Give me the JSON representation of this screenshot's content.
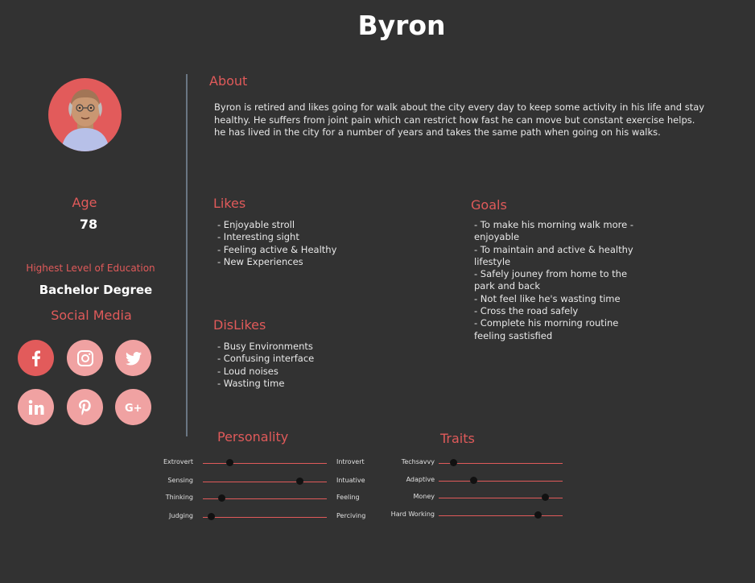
{
  "name": "Byron",
  "about": {
    "heading": "About",
    "text": "Byron is retired and likes going for walk about the city every day to keep some activity in his life and stay healthy. He suffers from joint pain which can restrict how fast he can move but constant exercise helps. he has lived in the city for a number of years and takes the same path when going on his walks."
  },
  "profile": {
    "age_label": "Age",
    "age_value": "78",
    "education_label": "Highest Level of Education",
    "education_value": "Bachelor Degree",
    "social_label": "Social Media",
    "social_icons": [
      "facebook-icon",
      "instagram-icon",
      "twitter-icon",
      "linkedin-icon",
      "pinterest-icon",
      "google-plus-icon"
    ]
  },
  "likes": {
    "heading": "Likes",
    "items": [
      "- Enjoyable stroll",
      "- Interesting sight",
      "- Feeling active & Healthy",
      "- New Experiences"
    ]
  },
  "dislikes": {
    "heading": "DisLikes",
    "items": [
      "- Busy Environments",
      "- Confusing interface",
      "- Loud noises",
      "- Wasting time"
    ]
  },
  "goals": {
    "heading": "Goals",
    "items": [
      "- To make his morning walk more -",
      "enjoyable",
      "- To maintain and active & healthy",
      "lifestyle",
      "- Safely jouney from home to the",
      "park and back",
      "- Not feel like he's wasting time",
      "- Cross the road safely",
      "- Complete his morning routine",
      "feeling sastisfied"
    ]
  },
  "personality": {
    "heading": "Personality",
    "rows": [
      {
        "left": "Extrovert",
        "right": "Introvert",
        "value": 0.22
      },
      {
        "left": "Sensing",
        "right": "Intuative",
        "value": 0.78
      },
      {
        "left": "Thinking",
        "right": "Feeling",
        "value": 0.15
      },
      {
        "left": "Judging",
        "right": "Perciving",
        "value": 0.07
      }
    ]
  },
  "traits": {
    "heading": "Traits",
    "rows": [
      {
        "label": "Techsavvy",
        "value": 0.12
      },
      {
        "label": "Adaptive",
        "value": 0.28
      },
      {
        "label": "Money",
        "value": 0.86
      },
      {
        "label": "Hard Working",
        "value": 0.8
      }
    ]
  },
  "colors": {
    "background": "#323232",
    "accent": "#e05a5a",
    "social_light": "#f0a2a2"
  }
}
